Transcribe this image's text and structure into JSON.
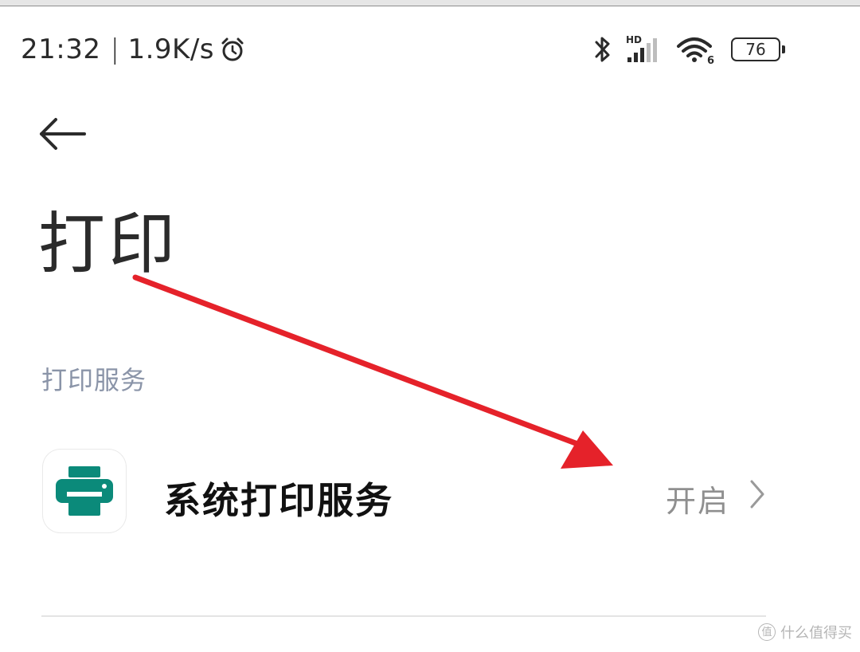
{
  "status_bar": {
    "time": "21:32",
    "separator": "|",
    "network_speed": "1.9K/s",
    "signal_label": "HD",
    "wifi_badge": "6",
    "battery_level": "76",
    "icons": [
      "alarm-icon",
      "bluetooth-icon",
      "cellular-signal-icon",
      "wifi-icon",
      "battery-icon"
    ]
  },
  "header": {
    "back_icon": "back-arrow-icon",
    "title": "打印"
  },
  "section": {
    "header": "打印服务",
    "items": [
      {
        "icon": "printer-icon",
        "title": "系统打印服务",
        "value": "开启",
        "chevron_icon": "chevron-right-icon"
      }
    ]
  },
  "watermark": {
    "badge": "值",
    "text": "什么值得买"
  },
  "colors": {
    "accent_teal": "#0b8a7a",
    "annotation_red": "#e5222a",
    "section_header": "#8a94a8",
    "value_gray": "#8f8f8f"
  }
}
